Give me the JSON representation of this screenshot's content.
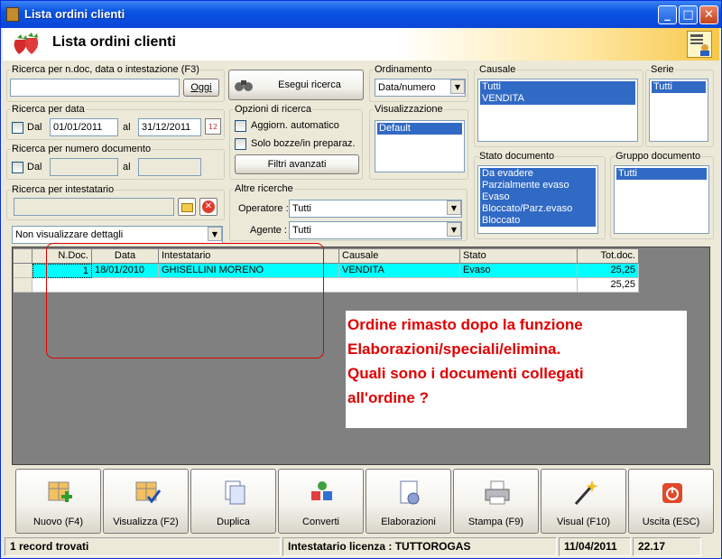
{
  "window": {
    "title": "Lista ordini clienti"
  },
  "header": {
    "title": "Lista ordini clienti"
  },
  "search_doc": {
    "legend": "Ricerca per n.doc, data o intestazione (F3)",
    "value": "",
    "btn": "Oggi"
  },
  "search_date": {
    "legend": "Ricerca per data",
    "dal": "Dal",
    "from": "01/01/2011",
    "al": "al",
    "to": "31/12/2011"
  },
  "search_num": {
    "legend": "Ricerca per numero documento",
    "dal": "Dal",
    "al": "al",
    "from": "",
    "to": ""
  },
  "search_owner": {
    "legend": "Ricerca per intestatario",
    "value": ""
  },
  "details_select": {
    "value": "Non visualizzare dettagli"
  },
  "run_search": {
    "label": "Esegui ricerca"
  },
  "options": {
    "legend": "Opzioni di ricerca",
    "auto": "Aggiorn. automatico",
    "drafts": "Solo bozze/in preparaz.",
    "filters": "Filtri avanzati"
  },
  "other": {
    "legend": "Altre ricerche",
    "operatore_label": "Operatore :",
    "operatore_value": "Tutti",
    "agente_label": "Agente :",
    "agente_value": "Tutti"
  },
  "order": {
    "legend": "Ordinamento",
    "value": "Data/numero"
  },
  "view": {
    "legend": "Visualizzazione",
    "items": [
      "Default"
    ]
  },
  "causale": {
    "legend": "Causale",
    "items": [
      "Tutti",
      "VENDITA"
    ]
  },
  "serie": {
    "legend": "Serie",
    "items": [
      "Tutti"
    ]
  },
  "stato": {
    "legend": "Stato documento",
    "items": [
      "Da evadere",
      "Parzialmente evaso",
      "Evaso",
      "Bloccato/Parz.evaso",
      "Bloccato"
    ]
  },
  "gruppo": {
    "legend": "Gruppo documento",
    "items": [
      "Tutti"
    ]
  },
  "grid": {
    "headers": [
      "N.Doc.",
      "Data",
      "Intestatario",
      "Causale",
      "Stato",
      "Tot.doc."
    ],
    "rows": [
      {
        "ndoc": "1",
        "data": "18/01/2010",
        "intestatario": "GHISELLINI MORENO",
        "causale": "VENDITA",
        "stato": "Evaso",
        "tot": "25,25"
      }
    ],
    "total": "25,25"
  },
  "note": {
    "lines": [
      "Ordine rimasto dopo la funzione",
      "Elaborazioni/speciali/elimina.",
      "Quali sono i documenti collegati",
      "all'ordine ?"
    ]
  },
  "toolbar": [
    "Nuovo (F4)",
    "Visualizza (F2)",
    "Duplica",
    "Converti",
    "Elaborazioni",
    "Stampa (F9)",
    "Visual (F10)",
    "Uscita (ESC)"
  ],
  "status": {
    "records": "1 record trovati",
    "license": "Intestatario licenza : TUTTOROGAS",
    "date": "11/04/2011",
    "time": "22.17"
  }
}
